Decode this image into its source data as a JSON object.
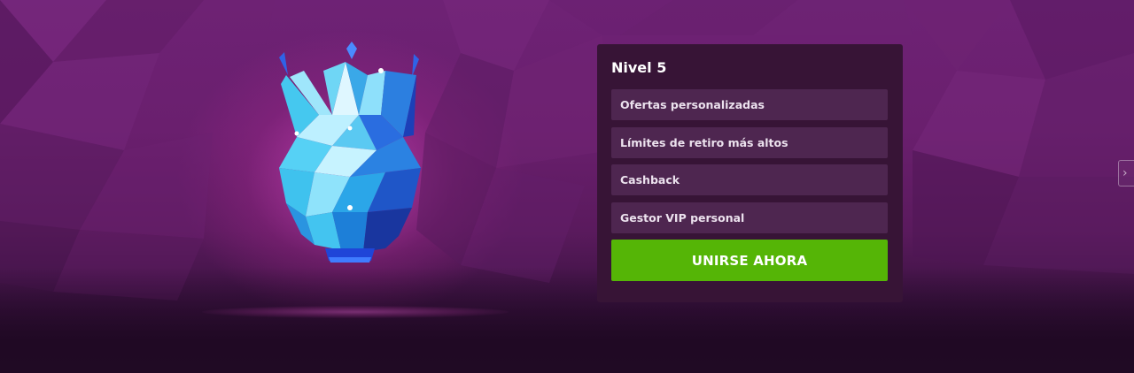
{
  "level_card": {
    "title": "Nivel 5",
    "benefits": [
      "Ofertas personalizadas",
      "Límites de retiro más altos",
      "Cashback",
      "Gestor VIP personal"
    ],
    "join_label": "UNIRSE AHORA"
  },
  "carousel": {
    "next_glyph": "›"
  },
  "icons": {
    "gem": "diamond-crown-icon",
    "next": "chevron-right-icon"
  },
  "colors": {
    "background": "#6a1f6e",
    "card": "#371436",
    "benefit_row": "#4e2650",
    "join_button": "#55b506",
    "text": "#ffffff"
  }
}
